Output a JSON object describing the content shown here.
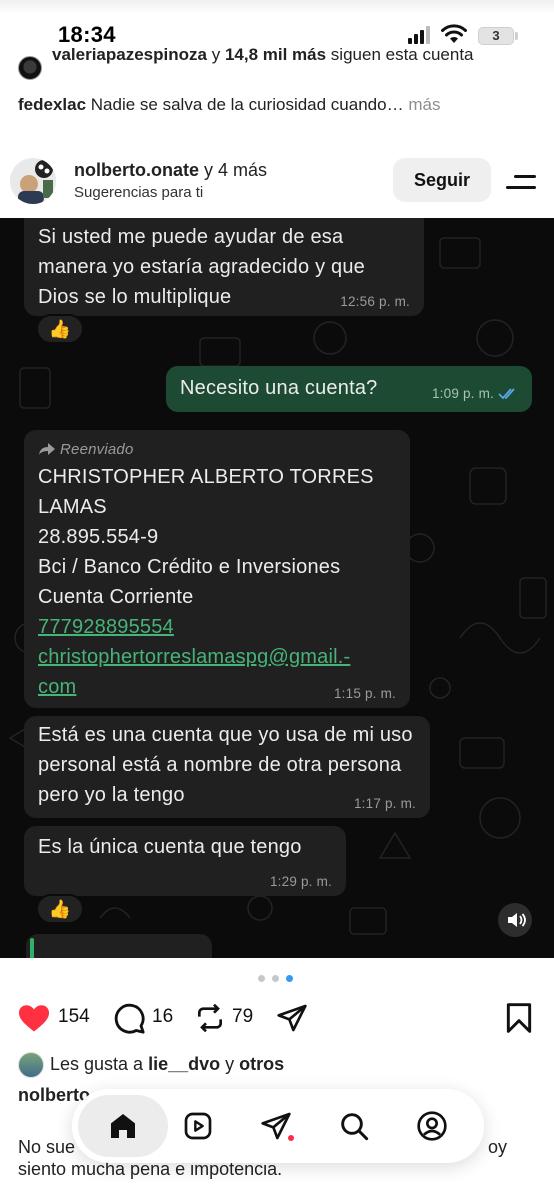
{
  "status_bar": {
    "time": "18:34",
    "battery": "3"
  },
  "follow_notice": {
    "user": "valeriapazespinoza",
    "joiner": "y",
    "others": "14,8 mil más",
    "rest": "siguen esta cuenta"
  },
  "top_caption": {
    "user": "fedexlac",
    "text": "Nadie se salva de la curiosidad cuando…",
    "more": "más"
  },
  "post_header": {
    "names": "nolberto.onate",
    "names_suffix": "y 4 más",
    "subtitle": "Sugerencias para ti",
    "follow_button": "Seguir"
  },
  "chat": {
    "messages": [
      {
        "dir": "in",
        "text": "Si usted me puede ayudar de esa manera yo estaría agradecido y que Dios se lo multiplique",
        "time": "12:56 p. m.",
        "reaction": "👍"
      },
      {
        "dir": "out",
        "text": "Necesito una cuenta?",
        "time": "1:09 p. m."
      },
      {
        "dir": "in",
        "forwarded": "Reenviado",
        "lines": [
          "CHRISTOPHER ALBERTO TORRES",
          "LAMAS",
          "28.895.554-9",
          "Bci / Banco Crédito e Inversiones",
          "Cuenta Corriente"
        ],
        "link1": "777928895554",
        "link2a": "christophertorreslamaspg@gmail.-",
        "link2b": "com",
        "time": "1:15 p. m."
      },
      {
        "dir": "in",
        "text": "Está es una cuenta que yo usa de mi uso personal está a nombre de otra persona pero yo la tengo",
        "time": "1:17 p. m."
      },
      {
        "dir": "in",
        "text": "Es la única cuenta que tengo",
        "time": "1:29 p. m.",
        "reaction": "👍"
      }
    ]
  },
  "actions": {
    "likes": "154",
    "comments": "16",
    "reposts": "79"
  },
  "liked_by": {
    "prefix": "Les gusta a",
    "user": "lie__dvo",
    "joiner": "y",
    "others": "otros"
  },
  "caption": {
    "user": "nolberto",
    "line1_start": "No sue",
    "line1_end": "oy",
    "line2": "siento mucha pena e impotencia."
  },
  "colors": {
    "heart": "#ff3040",
    "chat_bg": "#0b0b0b",
    "bubble_in": "#202020",
    "bubble_out": "#1c4a32",
    "link": "#46b478"
  }
}
